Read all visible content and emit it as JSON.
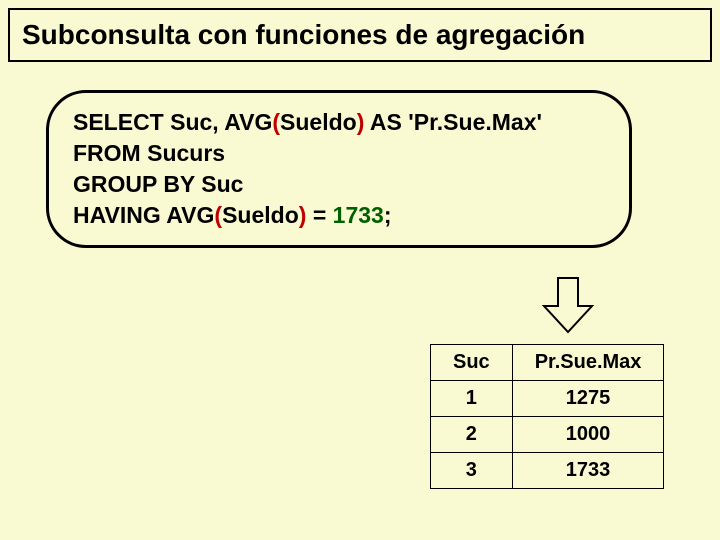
{
  "title": "Subconsulta con funciones de agregación",
  "sql": {
    "select_kw": "SELECT ",
    "select_cols": "Suc, AVG",
    "open1": "(",
    "arg1": "Sueldo",
    "close1": ")",
    "as_kw": " AS ",
    "alias_open": "'",
    "alias": "Pr.Sue.Max",
    "alias_close": "'",
    "from_line": "FROM Sucurs",
    "group_line": "GROUP BY Suc",
    "having_kw": "HAVING AVG",
    "open2": "(",
    "arg2": "Sueldo",
    "close2": ")",
    "eq": " = ",
    "val": "1733",
    "semi": ";"
  },
  "table": {
    "headers": [
      "Suc",
      "Pr.Sue.Max"
    ],
    "rows": [
      [
        "1",
        "1275"
      ],
      [
        "2",
        "1000"
      ],
      [
        "3",
        "1733"
      ]
    ]
  }
}
